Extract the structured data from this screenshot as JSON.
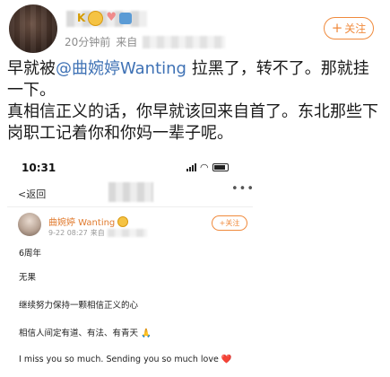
{
  "post": {
    "follow_label": "关注",
    "follow_plus": "+",
    "time": "20分钟前",
    "source_label": "来自",
    "text_before_mention": "早就被",
    "mention": "@曲婉婷Wanting",
    "text_after_mention": " 拉黑了，转不了。那就挂一下。",
    "paragraph2": "真相信正义的话，你早就该回来自首了。东北那些下岗职工记着你和你妈一辈子呢。"
  },
  "screenshot": {
    "status_time": "10:31",
    "back_label": "返回",
    "back_arrow": "<",
    "more_icon": "•••",
    "author_name": "曲婉婷 Wanting",
    "date": "9-22 08:27",
    "source_label": "来自",
    "follow_label": "关注",
    "follow_plus": "+",
    "lines": [
      "6周年",
      "无果",
      "继续努力保持一颗相信正义的心",
      "相信人间定有道、有法、有青天 🙏",
      "I miss you so much. Sending you so much love ❤️"
    ]
  },
  "icons": {
    "badge_k": "K",
    "heart": "♥",
    "wifi": "◠"
  },
  "colors": {
    "accent_orange": "#f08a3c",
    "mention_blue": "#3f72b5",
    "meta_gray": "#8c8c8c"
  }
}
